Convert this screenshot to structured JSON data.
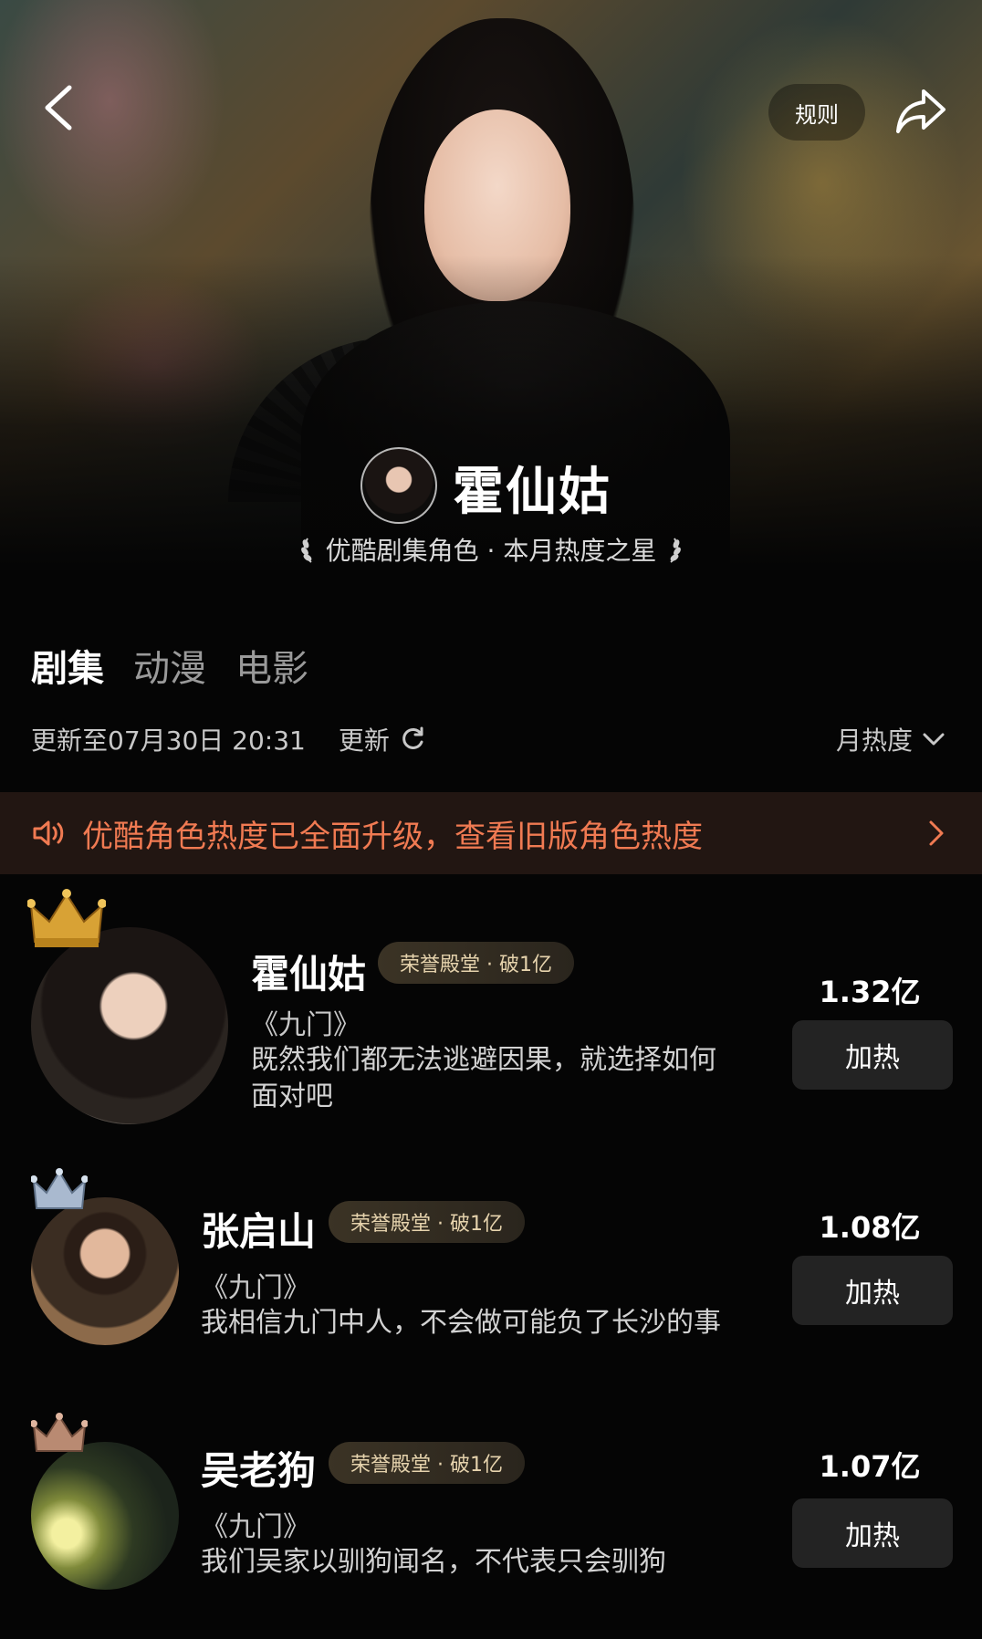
{
  "header": {
    "rules_label": "规则",
    "character_name": "霍仙姑",
    "subtitle": "优酷剧集角色 · 本月热度之星"
  },
  "tabs": [
    {
      "label": "剧集",
      "active": true
    },
    {
      "label": "动漫",
      "active": false
    },
    {
      "label": "电影",
      "active": false
    }
  ],
  "update": {
    "time_text": "更新至07月30日 20:31",
    "refresh_label": "更新",
    "sort_label": "月热度"
  },
  "notice": {
    "text": "优酷角色热度已全面升级，查看旧版角色热度",
    "color": "#f07a52"
  },
  "rankings": [
    {
      "rank": 1,
      "crown": "gold-crown-icon",
      "name": "霍仙姑",
      "badge": "荣誉殿堂 · 破1亿",
      "show": "《九门》",
      "quote_line1": "既然我们都无法逃避因果，就选择如何",
      "quote_line2": "面对吧",
      "heat": "1.32亿",
      "button": "加热"
    },
    {
      "rank": 2,
      "crown": "silver-crown-icon",
      "name": "张启山",
      "badge": "荣誉殿堂 · 破1亿",
      "show": "《九门》",
      "quote_line1": "我相信九门中人，不会做可能负了长沙的事",
      "heat": "1.08亿",
      "button": "加热"
    },
    {
      "rank": 3,
      "crown": "bronze-crown-icon",
      "name": "吴老狗",
      "badge": "荣誉殿堂 · 破1亿",
      "show": "《九门》",
      "quote_line1": "我们吴家以驯狗闻名，不代表只会驯狗",
      "heat": "1.07亿",
      "button": "加热"
    }
  ]
}
